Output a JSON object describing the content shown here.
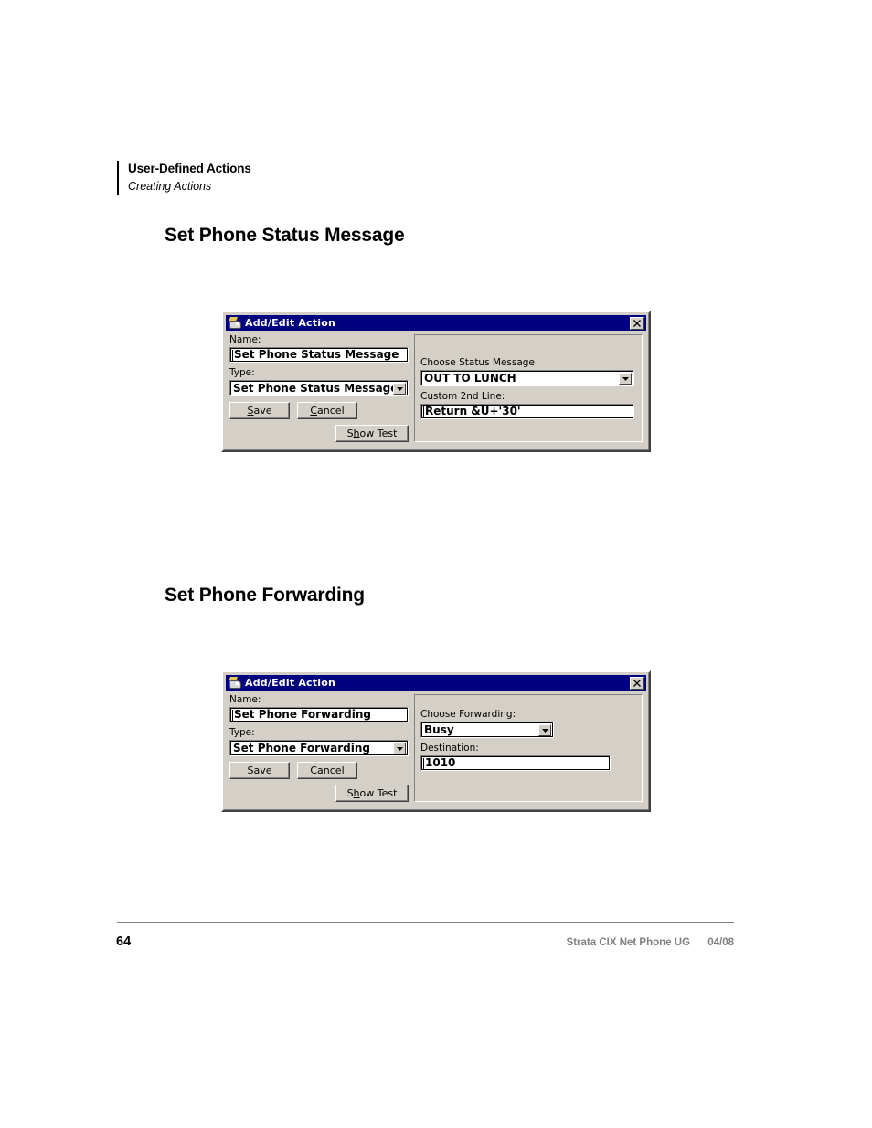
{
  "page": {
    "running_head_title": "User-Defined Actions",
    "running_head_subtitle": "Creating Actions",
    "page_number": "64",
    "footer_document": "Strata CIX Net Phone UG",
    "footer_date": "04/08"
  },
  "sections": [
    {
      "heading": "Set Phone Status Message"
    },
    {
      "heading": "Set Phone Forwarding"
    }
  ],
  "dialog_status": {
    "title": "Add/Edit Action",
    "close_label": "x",
    "name_label": "Name:",
    "name_value": "Set Phone Status Message",
    "type_label": "Type:",
    "type_value": "Set Phone Status Message",
    "save_label": "Save",
    "save_accel": "S",
    "save_rest": "ave",
    "cancel_label": "Cancel",
    "cancel_accel": "C",
    "cancel_rest": "ancel",
    "show_test_label": "Show Test",
    "show_test_pre": "S",
    "show_test_accel": "h",
    "show_test_rest": "ow Test",
    "choose_label": "Choose Status Message",
    "choose_value": "OUT TO LUNCH",
    "custom_label": "Custom 2nd Line:",
    "custom_value": "Return &U+'30'"
  },
  "dialog_forwarding": {
    "title": "Add/Edit Action",
    "close_label": "x",
    "name_label": "Name:",
    "name_value": "Set Phone Forwarding",
    "type_label": "Type:",
    "type_value": "Set Phone Forwarding",
    "save_label": "Save",
    "save_accel": "S",
    "save_rest": "ave",
    "cancel_label": "Cancel",
    "cancel_accel": "C",
    "cancel_rest": "ancel",
    "show_test_label": "Show Test",
    "show_test_pre": "S",
    "show_test_accel": "h",
    "show_test_rest": "ow Test",
    "choose_label": "Choose Forwarding:",
    "choose_value": "Busy",
    "destination_label": "Destination:",
    "destination_value": "1010"
  },
  "colors": {
    "titlebar": "#000080",
    "dialog_face": "#d4d0c8",
    "field_bg": "#ffffff",
    "footer_gray": "#808080"
  }
}
